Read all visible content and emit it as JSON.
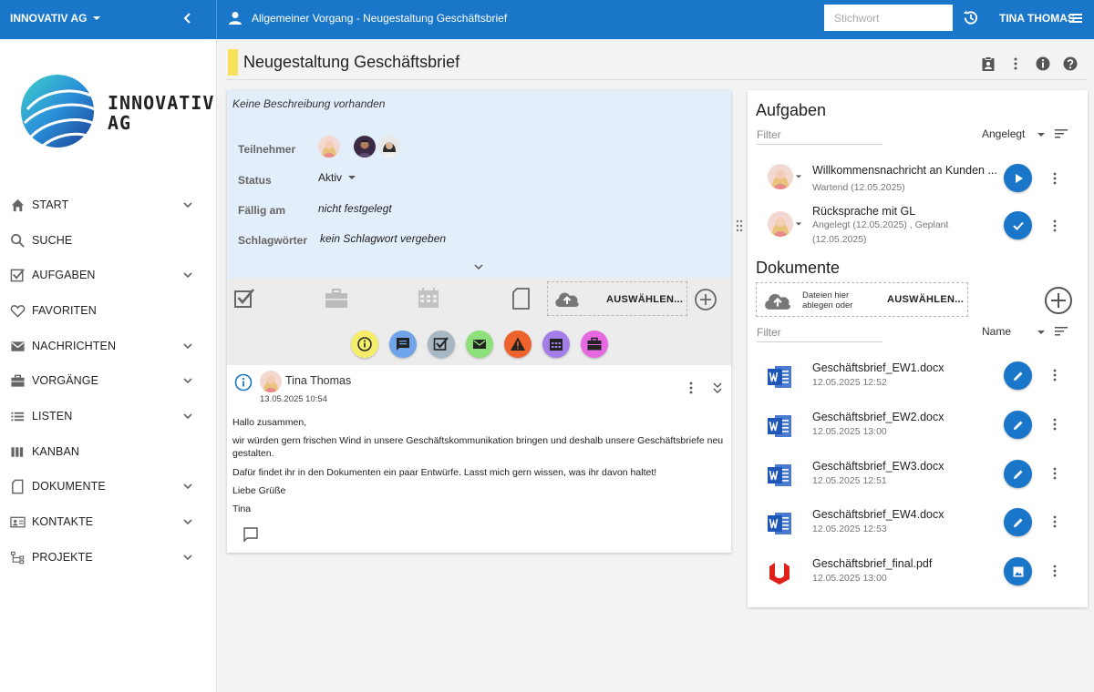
{
  "topbar": {
    "company": "INNOVATIV AG",
    "breadcrumb_title": "Allgemeiner Vorgang - Neugestaltung Geschäftsbrief",
    "search_placeholder": "Stichwort",
    "user_name": "TINA THOMAS"
  },
  "sidebar": {
    "logo_line1": "INNOVATIV",
    "logo_line2": "AG",
    "items": [
      {
        "label": "START",
        "icon": "home-icon",
        "expandable": true
      },
      {
        "label": "SUCHE",
        "icon": "search-icon",
        "expandable": false
      },
      {
        "label": "AUFGABEN",
        "icon": "checkbox-icon",
        "expandable": true
      },
      {
        "label": "FAVORITEN",
        "icon": "heart-icon",
        "expandable": false
      },
      {
        "label": "NACHRICHTEN",
        "icon": "mail-icon",
        "expandable": true
      },
      {
        "label": "VORGÄNGE",
        "icon": "briefcase-icon",
        "expandable": true
      },
      {
        "label": "LISTEN",
        "icon": "list-icon",
        "expandable": true
      },
      {
        "label": "KANBAN",
        "icon": "kanban-icon",
        "expandable": false
      },
      {
        "label": "DOKUMENTE",
        "icon": "document-icon",
        "expandable": true
      },
      {
        "label": "KONTAKTE",
        "icon": "contact-card-icon",
        "expandable": true
      },
      {
        "label": "PROJEKTE",
        "icon": "project-tree-icon",
        "expandable": true
      }
    ]
  },
  "page": {
    "title": "Neugestaltung Geschäftsbrief",
    "accent_color": "#f7e35a"
  },
  "details": {
    "description": "Keine Beschreibung vorhanden",
    "participants_label": "Teilnehmer",
    "status_label": "Status",
    "status_value": "Aktiv",
    "due_label": "Fällig am",
    "due_value": "nicht festgelegt",
    "tags_label": "Schlagwörter",
    "tags_value": "kein Schlagwort vergeben",
    "upload_label": "AUSWÄHLEN..."
  },
  "actions": [
    {
      "name": "info-action",
      "color": "#f4ee6a"
    },
    {
      "name": "comment-action",
      "color": "#6fa3ea"
    },
    {
      "name": "task-action",
      "color": "#a7b8c4"
    },
    {
      "name": "email-action",
      "color": "#8ee07a"
    },
    {
      "name": "warning-action",
      "color": "#f0622c"
    },
    {
      "name": "appointment-action",
      "color": "#a37ee8"
    },
    {
      "name": "case-action",
      "color": "#e769e2"
    }
  ],
  "post": {
    "author": "Tina Thomas",
    "date": "13.05.2025 10:54",
    "lines": [
      "Hallo zusammen,",
      "wir würden gern frischen Wind in unsere Geschäftskommunikation bringen und deshalb unsere Geschäftsbriefe neu gestalten.",
      "Dafür findet ihr in den Dokumenten ein paar Entwürfe. Lasst mich gern wissen, was ihr davon haltet!",
      "Liebe Grüße",
      "Tina"
    ]
  },
  "tasks": {
    "title": "Aufgaben",
    "filter_placeholder": "Filter",
    "sort_value": "Angelegt",
    "items": [
      {
        "title": "Willkommensnachricht an Kunden ...",
        "sub": "Wartend (12.05.2025)",
        "action": "play"
      },
      {
        "title": "Rücksprache mit GL",
        "sub": "Angelegt (12.05.2025) , Geplant (12.05.2025)",
        "action": "check"
      }
    ]
  },
  "documents": {
    "title": "Dokumente",
    "drop_hint_line1": "Dateien hier",
    "drop_hint_line2": "ablegen oder",
    "drop_button": "AUSWÄHLEN...",
    "filter_placeholder": "Filter",
    "sort_value": "Name",
    "items": [
      {
        "name": "Geschäftsbrief_EW1.docx",
        "date": "12.05.2025 12:52",
        "type": "word"
      },
      {
        "name": "Geschäftsbrief_EW2.docx",
        "date": "12.05.2025 13:00",
        "type": "word"
      },
      {
        "name": "Geschäftsbrief_EW3.docx",
        "date": "12.05.2025 12:51",
        "type": "word"
      },
      {
        "name": "Geschäftsbrief_EW4.docx",
        "date": "12.05.2025 12:53",
        "type": "word"
      },
      {
        "name": "Geschäftsbrief_final.pdf",
        "date": "12.05.2025 13:00",
        "type": "pdf"
      }
    ]
  },
  "colors": {
    "primary": "#1976c8",
    "info_bg": "#e3eefb"
  }
}
